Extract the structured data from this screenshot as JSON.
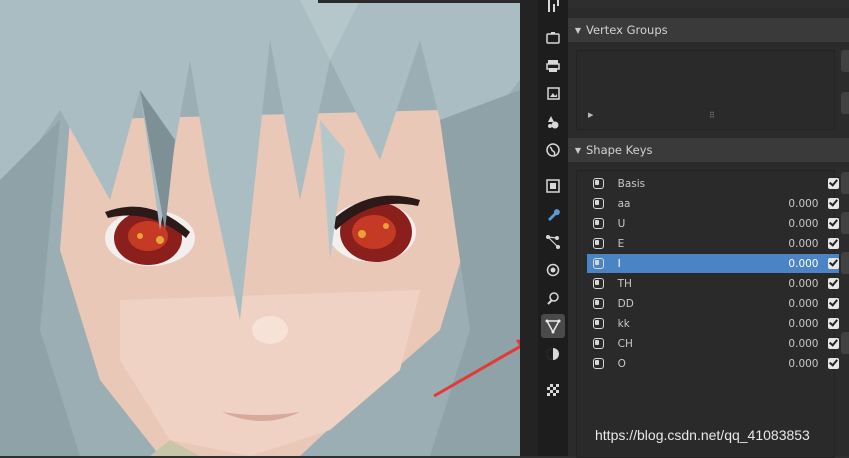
{
  "viewport": {
    "label": "3D Viewport - anime character face",
    "arrow_color": "#e53935"
  },
  "property_tabs": [
    {
      "name": "tool-tab",
      "icon": "tool-icon"
    },
    {
      "name": "render-tab",
      "icon": "camera-icon"
    },
    {
      "name": "output-tab",
      "icon": "printer-icon"
    },
    {
      "name": "view-layer-tab",
      "icon": "image-stack-icon"
    },
    {
      "name": "scene-tab",
      "icon": "scene-icon"
    },
    {
      "name": "world-tab",
      "icon": "globe-icon"
    },
    {
      "name": "object-tab",
      "icon": "object-square-icon"
    },
    {
      "name": "modifier-tab",
      "icon": "wrench-icon"
    },
    {
      "name": "particles-tab",
      "icon": "particles-icon"
    },
    {
      "name": "physics-tab",
      "icon": "physics-orbit-icon"
    },
    {
      "name": "constraints-tab",
      "icon": "constraint-icon"
    },
    {
      "name": "data-tab",
      "icon": "mesh-data-icon",
      "active": true
    },
    {
      "name": "material-tab",
      "icon": "material-sphere-icon"
    },
    {
      "name": "texture-tab",
      "icon": "checker-icon"
    }
  ],
  "panels": {
    "vertex_groups": {
      "title": "Vertex Groups",
      "collapse_symbol": "▼"
    },
    "shape_keys": {
      "title": "Shape Keys",
      "collapse_symbol": "▼"
    }
  },
  "shape_keys": [
    {
      "name": "Basis",
      "value": "",
      "checked": true
    },
    {
      "name": "aa",
      "value": "0.000",
      "checked": true
    },
    {
      "name": "U",
      "value": "0.000",
      "checked": true
    },
    {
      "name": "E",
      "value": "0.000",
      "checked": true
    },
    {
      "name": "I",
      "value": "0.000",
      "checked": true,
      "selected": true
    },
    {
      "name": "TH",
      "value": "0.000",
      "checked": true
    },
    {
      "name": "DD",
      "value": "0.000",
      "checked": true
    },
    {
      "name": "kk",
      "value": "0.000",
      "checked": true
    },
    {
      "name": "CH",
      "value": "0.000",
      "checked": true
    },
    {
      "name": "O",
      "value": "0.000",
      "checked": true
    }
  ],
  "watermark": "https://blog.csdn.net/qq_41083853",
  "colors": {
    "selected_row": "#4a84c4",
    "header_bg": "#3a3a3a",
    "tab_bar_bg": "#1d1d1d"
  }
}
